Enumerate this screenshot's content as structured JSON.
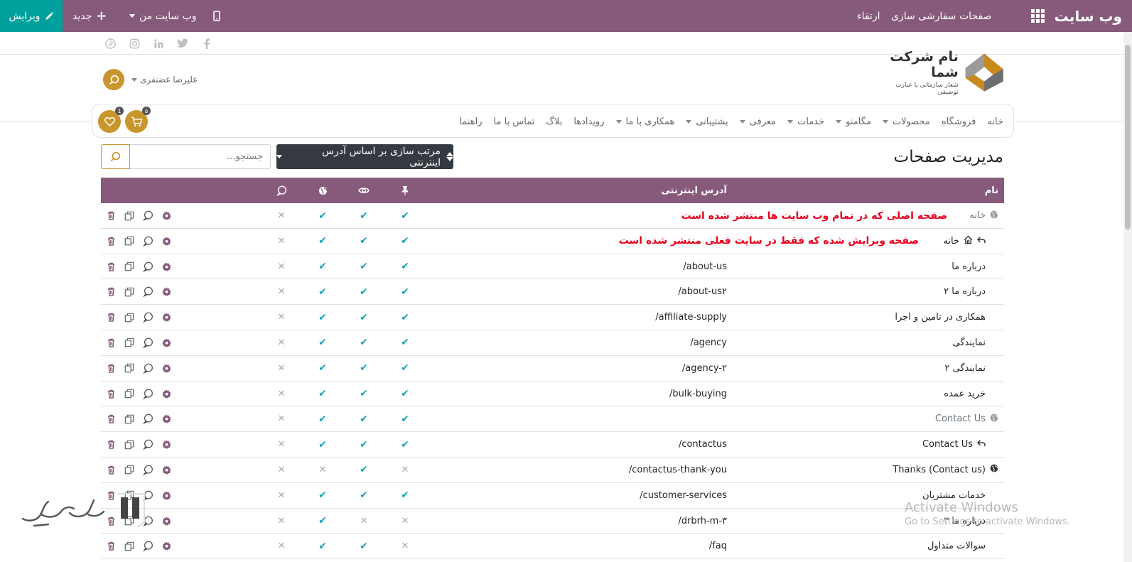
{
  "topbar": {
    "brand": "وب سایت",
    "menu": [
      "صفحات",
      "سفارشی سازی",
      "ارتقاء"
    ],
    "my_site": "وب سایت من",
    "new": "جدید",
    "edit": "ویرایش",
    "bg_color": "#875a7b",
    "edit_color": "#00a09d"
  },
  "social": [
    "facebook-icon",
    "twitter-icon",
    "linkedin-icon",
    "instagram-icon",
    "pinterest-icon"
  ],
  "logo": {
    "company": "نام شرکت شما",
    "slogan": "شعار سازمانی یا عبارت توصیفی"
  },
  "user": {
    "name": "علیرضا غضنفری"
  },
  "nav": {
    "items": [
      {
        "label": "خانه",
        "dropdown": false
      },
      {
        "label": "فروشگاه",
        "dropdown": false
      },
      {
        "label": "محصولات",
        "dropdown": true
      },
      {
        "label": "مگامنو",
        "dropdown": true
      },
      {
        "label": "خدمات",
        "dropdown": true
      },
      {
        "label": "معرفی",
        "dropdown": true
      },
      {
        "label": "پشتیبانی",
        "dropdown": true
      },
      {
        "label": "همکاری با ما",
        "dropdown": true
      },
      {
        "label": "رویدادها",
        "dropdown": false
      },
      {
        "label": "بلاگ",
        "dropdown": false
      },
      {
        "label": "تماس با ما",
        "dropdown": false
      },
      {
        "label": "راهنما",
        "dropdown": false
      }
    ],
    "cart_count": "۵",
    "wishlist_count": "1"
  },
  "page": {
    "title": "مدیریت صفحات",
    "sort_label": "مرتب سازی بر اساس آدرس اینترنتی",
    "search_placeholder": "جستجو..."
  },
  "table": {
    "headers": {
      "name": "نام",
      "url": "آدرس اینترنتی"
    },
    "rows": [
      {
        "name": "خانه",
        "url": "",
        "note": "صفحه اصلی که در تمام وب سایت ها منتشر شده است",
        "type": "global",
        "pin": true,
        "visible": true,
        "published": true,
        "indexed": false
      },
      {
        "name": "خانه",
        "url": "",
        "note": "صفحه ویرایش شده که فقط در سایت فعلی منتشر شده است",
        "type": "home-child",
        "pin": true,
        "visible": true,
        "published": true,
        "indexed": false
      },
      {
        "name": "درباره ما",
        "url": "/about-us",
        "note": "",
        "type": "plain",
        "pin": true,
        "visible": true,
        "published": true,
        "indexed": false
      },
      {
        "name": "درباره ما ۲",
        "url": "/about-us۲",
        "note": "",
        "type": "plain",
        "pin": true,
        "visible": true,
        "published": true,
        "indexed": false
      },
      {
        "name": "همکاری در تامین و اجرا",
        "url": "/affiliate-supply",
        "note": "",
        "type": "plain",
        "pin": true,
        "visible": true,
        "published": true,
        "indexed": false
      },
      {
        "name": "نمایندگی",
        "url": "/agency",
        "note": "",
        "type": "plain",
        "pin": true,
        "visible": true,
        "published": true,
        "indexed": false
      },
      {
        "name": "نمایندگی ۲",
        "url": "/agency-۲",
        "note": "",
        "type": "plain",
        "pin": true,
        "visible": true,
        "published": true,
        "indexed": false
      },
      {
        "name": "خرید عمده",
        "url": "/bulk-buying",
        "note": "",
        "type": "plain",
        "pin": true,
        "visible": true,
        "published": true,
        "indexed": false
      },
      {
        "name": "Contact Us",
        "url": "",
        "note": "",
        "type": "global",
        "pin": true,
        "visible": true,
        "published": true,
        "indexed": false
      },
      {
        "name": "Contact Us",
        "url": "/contactus",
        "note": "",
        "type": "child",
        "pin": true,
        "visible": true,
        "published": true,
        "indexed": false
      },
      {
        "name": "Thanks (Contact us)",
        "url": "/contactus-thank-you",
        "note": "",
        "type": "globe-dark",
        "pin": false,
        "visible": true,
        "published": false,
        "indexed": false
      },
      {
        "name": "خدمات مشتریان",
        "url": "/customer-services",
        "note": "",
        "type": "plain",
        "pin": true,
        "visible": true,
        "published": true,
        "indexed": false
      },
      {
        "name": "درباره ما ۳",
        "url": "/drbrh-m-۳",
        "note": "",
        "type": "plain",
        "pin": false,
        "visible": false,
        "published": true,
        "indexed": false
      },
      {
        "name": "سوالات متداول",
        "url": "/faq",
        "note": "",
        "type": "plain",
        "pin": false,
        "visible": true,
        "published": true,
        "indexed": false
      }
    ]
  },
  "overlay": {
    "activate_1": "Activate Windows",
    "activate_2": "Go to Settings to activate Windows."
  },
  "colors": {
    "accent": "#875a7b",
    "teal": "#00a09d",
    "gold": "#c9952d",
    "check": "#17a2b8",
    "note_red": "#e8001c"
  }
}
